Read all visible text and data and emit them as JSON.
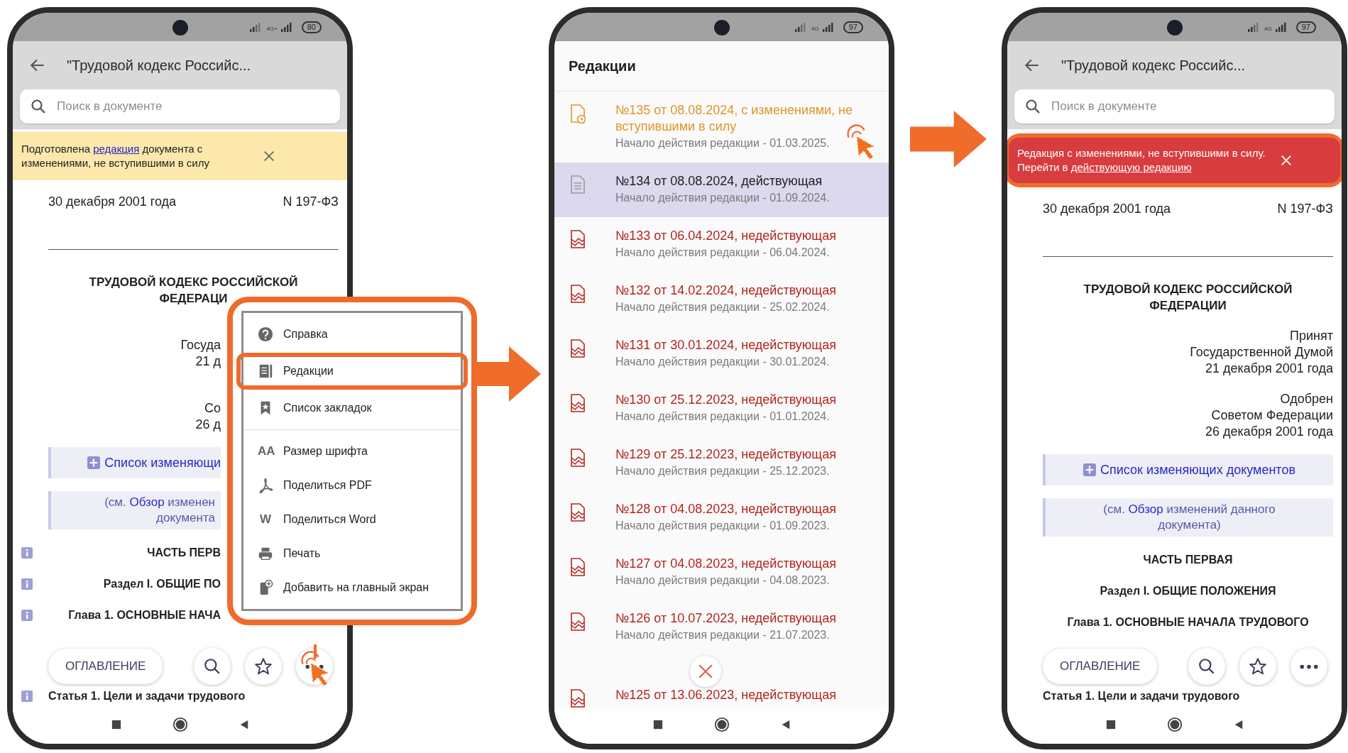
{
  "screens": [
    {
      "kind": "document",
      "status_bar": {
        "network_label": "4G+",
        "battery": "80"
      },
      "title": "\"Трудовой кодекс Российс...",
      "search": {
        "placeholder": "Поиск в документе"
      },
      "banner": {
        "kind": "notice",
        "before": "Подготовлена ",
        "link": "редакция",
        "after": " документа с изменениями, не вступившими в силу",
        "highlighted": false
      },
      "date": "30 декабря 2001 года",
      "number": "N 197-ФЗ",
      "heading": [
        "ТРУДОВОЙ КОДЕКС РОССИЙСКОЙ",
        "ФЕДЕРАЦИ"
      ],
      "blocks": [
        {
          "kind": "signature",
          "lines": [
            "Госуда",
            "21 д"
          ]
        },
        {
          "kind": "signature",
          "lines": [
            "Со",
            "26 д"
          ]
        },
        {
          "kind": "changes",
          "label": "Список изменяющи"
        },
        {
          "kind": "overview",
          "before": "(см. ",
          "link": "Обзор",
          "after": " изменен",
          "line2": "документа"
        },
        {
          "kind": "heading",
          "text": "ЧАСТЬ ПЕРВ",
          "info": true
        },
        {
          "kind": "heading",
          "text": "Раздел I. ОБЩИЕ ПО",
          "info": true
        },
        {
          "kind": "heading",
          "text": "Глава 1. ОСНОВНЫЕ НАЧА",
          "info": true
        }
      ],
      "toolbar": {
        "contents": "ОГЛАВЛЕНИЕ",
        "more_tapped": true
      },
      "article": {
        "text": "Статья 1. Цели и задачи трудового",
        "info": true
      },
      "menu": {
        "highlighted": true,
        "groups": [
          [
            {
              "label": "Справка",
              "kind": "help",
              "highlighted": false
            },
            {
              "label": "Редакции",
              "kind": "revisions",
              "highlighted": true
            },
            {
              "label": "Список закладок",
              "kind": "bookmarks",
              "highlighted": false
            }
          ],
          [
            {
              "label": "Размер шрифта",
              "kind": "glyph",
              "glyph": "AA",
              "highlighted": false
            },
            {
              "label": "Поделиться PDF",
              "kind": "pdf",
              "highlighted": false
            },
            {
              "label": "Поделиться Word",
              "kind": "glyph",
              "glyph": "W",
              "highlighted": false
            },
            {
              "label": "Печать",
              "kind": "print",
              "highlighted": false
            },
            {
              "label": "Добавить на главный экран",
              "kind": "add_home",
              "highlighted": false
            }
          ]
        ]
      }
    },
    {
      "kind": "revisions",
      "status_bar": {
        "network_label": "4G",
        "battery": "97"
      },
      "title": "Редакции",
      "close_button": true,
      "items": [
        {
          "title": "№135 от 08.08.2024, с изменениями, не вступившими в силу",
          "start": "Начало действия редакции - 01.03.2025.",
          "kind": "pending",
          "selected": false,
          "tapped": true
        },
        {
          "title": "№134 от 08.08.2024, действующая",
          "start": "Начало действия редакции - 01.09.2024.",
          "kind": "current",
          "selected": true,
          "tapped": false
        },
        {
          "title": "№133 от 06.04.2024, недействующая",
          "start": "Начало действия редакции - 06.04.2024.",
          "kind": "inactive",
          "selected": false,
          "tapped": false
        },
        {
          "title": "№132 от 14.02.2024, недействующая",
          "start": "Начало действия редакции - 25.02.2024.",
          "kind": "inactive",
          "selected": false,
          "tapped": false
        },
        {
          "title": "№131 от 30.01.2024, недействующая",
          "start": "Начало действия редакции - 30.01.2024.",
          "kind": "inactive",
          "selected": false,
          "tapped": false
        },
        {
          "title": "№130 от 25.12.2023, недействующая",
          "start": "Начало действия редакции - 01.01.2024.",
          "kind": "inactive",
          "selected": false,
          "tapped": false
        },
        {
          "title": "№129 от 25.12.2023, недействующая",
          "start": "Начало действия редакции - 25.12.2023.",
          "kind": "inactive",
          "selected": false,
          "tapped": false
        },
        {
          "title": "№128 от 04.08.2023, недействующая",
          "start": "Начало действия редакции - 01.09.2023.",
          "kind": "inactive",
          "selected": false,
          "tapped": false
        },
        {
          "title": "№127 от 04.08.2023, недействующая",
          "start": "Начало действия редакции - 04.08.2023.",
          "kind": "inactive",
          "selected": false,
          "tapped": false
        },
        {
          "title": "№126 от 10.07.2023, недействующая",
          "start": "Начало действия редакции - 21.07.2023.",
          "kind": "inactive",
          "selected": false,
          "tapped": false
        },
        {
          "title": "№125 от 13.06.2023, недействующая",
          "kind": "inactive",
          "selected": false,
          "tapped": false
        }
      ]
    },
    {
      "kind": "document",
      "status_bar": {
        "network_label": "4G",
        "battery": "97"
      },
      "title": "\"Трудовой кодекс Российс...",
      "search": {
        "placeholder": "Поиск в документе"
      },
      "banner": {
        "kind": "warning",
        "before": "Редакция с изменениями, не вступившими в силу. Перейти в ",
        "link": "действующую редакцию",
        "highlighted": true
      },
      "date": "30 декабря 2001 года",
      "number": "N 197-ФЗ",
      "heading": [
        "ТРУДОВОЙ КОДЕКС РОССИЙСКОЙ",
        "ФЕДЕРАЦИИ"
      ],
      "blocks": [
        {
          "kind": "signature",
          "lines": [
            "Принят",
            "Государственной Думой",
            "21 декабря 2001 года"
          ]
        },
        {
          "kind": "signature",
          "lines": [
            "Одобрен",
            "Советом Федерации",
            "26 декабря 2001 года"
          ]
        },
        {
          "kind": "changes",
          "label": "Список изменяющих документов"
        },
        {
          "kind": "overview",
          "before": "(см. ",
          "link": "Обзор",
          "after": " изменений данного",
          "line2": "документа)"
        },
        {
          "kind": "heading",
          "text": "ЧАСТЬ ПЕРВАЯ",
          "info": false
        },
        {
          "kind": "heading",
          "text": "Раздел I. ОБЩИЕ ПОЛОЖЕНИЯ",
          "info": false
        },
        {
          "kind": "heading",
          "text": "Глава 1. ОСНОВНЫЕ НАЧАЛА ТРУДОВОГО",
          "info": false
        }
      ],
      "toolbar": {
        "contents": "ОГЛАВЛЕНИЕ",
        "more_tapped": false
      },
      "article": {
        "text": "Статья 1. Цели и задачи трудового",
        "info": false
      }
    }
  ]
}
